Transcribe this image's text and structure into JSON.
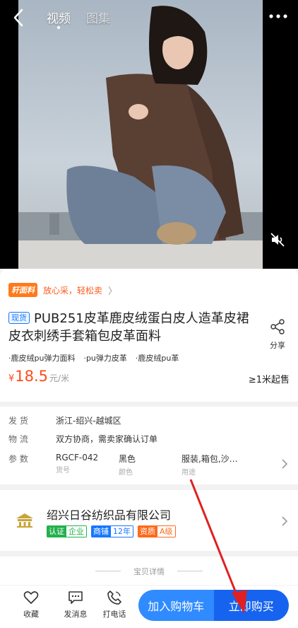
{
  "media": {
    "tabs": [
      "视频",
      "图集"
    ],
    "active_tab": 0
  },
  "promo": {
    "badge": "轩面料",
    "text": "放心采，轻松卖",
    "chevron": "〉"
  },
  "product": {
    "spot_badge": "现货",
    "title": "PUB251皮革鹿皮绒蛋白皮人造革皮裙皮衣刺绣手套箱包皮革面料",
    "share_label": "分享",
    "tags": [
      "·鹿皮绒pu弹力面料",
      "·pu弹力皮革",
      "·鹿皮绒pu革"
    ],
    "price_currency": "¥",
    "price_value": "18.5",
    "price_unit": "元/米",
    "moq": "≥1米起售",
    "accent_color": "#ff4a1a"
  },
  "spec": {
    "ship": {
      "key": "发 货",
      "value": "浙江-绍兴-越城区"
    },
    "logistics": {
      "key": "物 流",
      "value": "双方协商，需卖家确认订单"
    },
    "params_key": "参 数",
    "params": [
      {
        "value": "RGCF-042",
        "caption": "货号"
      },
      {
        "value": "黑色",
        "caption": "颜色"
      },
      {
        "value": "服装,箱包,沙…",
        "caption": "用途"
      }
    ]
  },
  "shop": {
    "name": "绍兴日谷纺织品有限公司",
    "badges": [
      {
        "key": "认证",
        "value": "企业",
        "color": "#22b14c"
      },
      {
        "key": "商铺",
        "value": "12年",
        "color": "#1677ff"
      },
      {
        "key": "资质",
        "value": "A级",
        "color": "#ff6a1a"
      }
    ]
  },
  "detail": {
    "label": "宝贝详情"
  },
  "bottom": {
    "favorite": "收藏",
    "message": "发消息",
    "call": "打电话",
    "add_to_cart": "加入购物车",
    "buy_now": "立即购买"
  },
  "icons": [
    "back-icon",
    "more-icon",
    "mute-icon",
    "share-icon",
    "chevron-right-icon",
    "heart-icon",
    "message-icon",
    "phone-icon",
    "shop-logo-icon"
  ]
}
